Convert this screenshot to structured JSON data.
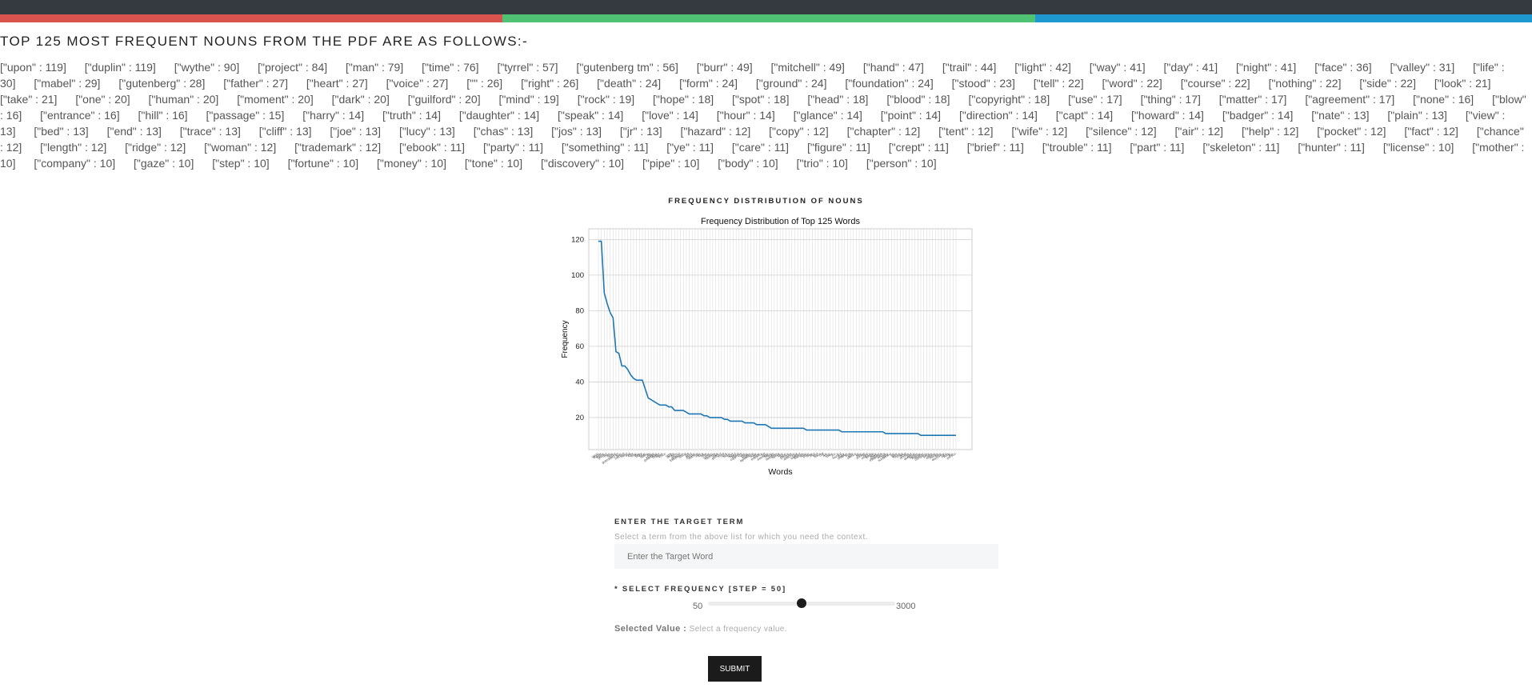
{
  "header": {
    "colors": {
      "bar": "#343a40",
      "stripe_red": "#d9534f",
      "stripe_green": "#4fc274",
      "stripe_blue": "#1f98d0"
    }
  },
  "heading": "TOP 125 MOST FREQUENT NOUNS FROM THE PDF ARE AS FOLLOWS:-",
  "words": [
    "[\"upon\" : 119]",
    "[\"duplin\" : 119]",
    "[\"wythe\" : 90]",
    "[\"project\" : 84]",
    "[\"man\" : 79]",
    "[\"time\" : 76]",
    "[\"tyrrel\" : 57]",
    "[\"gutenberg tm\" : 56]",
    "[\"burr\" : 49]",
    "[\"mitchell\" : 49]",
    "[\"hand\" : 47]",
    "[\"trail\" : 44]",
    "[\"light\" : 42]",
    "[\"way\" : 41]",
    "[\"day\" : 41]",
    "[\"night\" : 41]",
    "[\"face\" : 36]",
    "[\"valley\" : 31]",
    "[\"life\" : 30]",
    "[\"mabel\" : 29]",
    "[\"gutenberg\" : 28]",
    "[\"father\" : 27]",
    "[\"heart\" : 27]",
    "[\"voice\" : 27]",
    "[\"\" : 26]",
    "[\"right\" : 26]",
    "[\"death\" : 24]",
    "[\"form\" : 24]",
    "[\"ground\" : 24]",
    "[\"foundation\" : 24]",
    "[\"stood\" : 23]",
    "[\"tell\" : 22]",
    "[\"word\" : 22]",
    "[\"course\" : 22]",
    "[\"nothing\" : 22]",
    "[\"side\" : 22]",
    "[\"look\" : 21]",
    "[\"take\" : 21]",
    "[\"one\" : 20]",
    "[\"human\" : 20]",
    "[\"moment\" : 20]",
    "[\"dark\" : 20]",
    "[\"guilford\" : 20]",
    "[\"mind\" : 19]",
    "[\"rock\" : 19]",
    "[\"hope\" : 18]",
    "[\"spot\" : 18]",
    "[\"head\" : 18]",
    "[\"blood\" : 18]",
    "[\"copyright\" : 18]",
    "[\"use\" : 17]",
    "[\"thing\" : 17]",
    "[\"matter\" : 17]",
    "[\"agreement\" : 17]",
    "[\"none\" : 16]",
    "[\"blow\" : 16]",
    "[\"entrance\" : 16]",
    "[\"hill\" : 16]",
    "[\"passage\" : 15]",
    "[\"harry\" : 14]",
    "[\"truth\" : 14]",
    "[\"daughter\" : 14]",
    "[\"speak\" : 14]",
    "[\"love\" : 14]",
    "[\"hour\" : 14]",
    "[\"glance\" : 14]",
    "[\"point\" : 14]",
    "[\"direction\" : 14]",
    "[\"capt\" : 14]",
    "[\"howard\" : 14]",
    "[\"badger\" : 14]",
    "[\"nate\" : 13]",
    "[\"plain\" : 13]",
    "[\"view\" : 13]",
    "[\"bed\" : 13]",
    "[\"end\" : 13]",
    "[\"trace\" : 13]",
    "[\"cliff\" : 13]",
    "[\"joe\" : 13]",
    "[\"lucy\" : 13]",
    "[\"chas\" : 13]",
    "[\"jos\" : 13]",
    "[\"jr\" : 13]",
    "[\"hazard\" : 12]",
    "[\"copy\" : 12]",
    "[\"chapter\" : 12]",
    "[\"tent\" : 12]",
    "[\"wife\" : 12]",
    "[\"silence\" : 12]",
    "[\"air\" : 12]",
    "[\"help\" : 12]",
    "[\"pocket\" : 12]",
    "[\"fact\" : 12]",
    "[\"chance\" : 12]",
    "[\"length\" : 12]",
    "[\"ridge\" : 12]",
    "[\"woman\" : 12]",
    "[\"trademark\" : 12]",
    "[\"ebook\" : 11]",
    "[\"party\" : 11]",
    "[\"something\" : 11]",
    "[\"ye\" : 11]",
    "[\"care\" : 11]",
    "[\"figure\" : 11]",
    "[\"crept\" : 11]",
    "[\"brief\" : 11]",
    "[\"trouble\" : 11]",
    "[\"part\" : 11]",
    "[\"skeleton\" : 11]",
    "[\"hunter\" : 11]",
    "[\"license\" : 10]",
    "[\"mother\" : 10]",
    "[\"company\" : 10]",
    "[\"gaze\" : 10]",
    "[\"step\" : 10]",
    "[\"fortune\" : 10]",
    "[\"money\" : 10]",
    "[\"tone\" : 10]",
    "[\"discovery\" : 10]",
    "[\"pipe\" : 10]",
    "[\"body\" : 10]",
    "[\"trio\" : 10]",
    "[\"person\" : 10]"
  ],
  "chart_section_title": "FREQUENCY DISTRIBUTION OF NOUNS",
  "chart_data": {
    "type": "line",
    "title": "Frequency Distribution of Top 125 Words",
    "xlabel": "Words",
    "ylabel": "Frequency",
    "ylim": [
      0,
      125
    ],
    "yticks": [
      20,
      40,
      60,
      80,
      100,
      120
    ],
    "grid": true,
    "color": "#1f77b4",
    "x": [
      "upon",
      "duplin",
      "wythe",
      "project",
      "man",
      "time",
      "tyrrel",
      "gutenberg tm",
      "burr",
      "mitchell",
      "hand",
      "trail",
      "light",
      "way",
      "day",
      "night",
      "face",
      "valley",
      "life",
      "mabel",
      "gutenberg",
      "father",
      "heart",
      "voice",
      "",
      "right",
      "death",
      "form",
      "ground",
      "foundation",
      "stood",
      "tell",
      "word",
      "course",
      "nothing",
      "side",
      "look",
      "take",
      "one",
      "human",
      "moment",
      "dark",
      "guilford",
      "mind",
      "rock",
      "hope",
      "spot",
      "head",
      "blood",
      "copyright",
      "use",
      "thing",
      "matter",
      "agreement",
      "none",
      "blow",
      "entrance",
      "hill",
      "passage",
      "harry",
      "truth",
      "daughter",
      "speak",
      "love",
      "hour",
      "glance",
      "point",
      "direction",
      "capt",
      "howard",
      "badger",
      "nate",
      "plain",
      "view",
      "bed",
      "end",
      "trace",
      "cliff",
      "joe",
      "lucy",
      "chas",
      "jos",
      "jr",
      "hazard",
      "copy",
      "chapter",
      "tent",
      "wife",
      "silence",
      "air",
      "help",
      "pocket",
      "fact",
      "chance",
      "length",
      "ridge",
      "woman",
      "trademark",
      "ebook",
      "party",
      "something",
      "ye",
      "care",
      "figure",
      "crept",
      "brief",
      "trouble",
      "part",
      "skeleton",
      "hunter",
      "license",
      "mother",
      "company",
      "gaze",
      "step",
      "fortune",
      "money",
      "tone",
      "discovery",
      "pipe",
      "body",
      "trio",
      "person"
    ],
    "y": [
      119,
      119,
      90,
      84,
      79,
      76,
      57,
      56,
      49,
      49,
      47,
      44,
      42,
      41,
      41,
      41,
      36,
      31,
      30,
      29,
      28,
      27,
      27,
      27,
      26,
      26,
      24,
      24,
      24,
      24,
      23,
      22,
      22,
      22,
      22,
      22,
      21,
      21,
      20,
      20,
      20,
      20,
      20,
      19,
      19,
      18,
      18,
      18,
      18,
      18,
      17,
      17,
      17,
      17,
      16,
      16,
      16,
      16,
      15,
      14,
      14,
      14,
      14,
      14,
      14,
      14,
      14,
      14,
      14,
      14,
      14,
      13,
      13,
      13,
      13,
      13,
      13,
      13,
      13,
      13,
      13,
      13,
      13,
      12,
      12,
      12,
      12,
      12,
      12,
      12,
      12,
      12,
      12,
      12,
      12,
      12,
      12,
      12,
      11,
      11,
      11,
      11,
      11,
      11,
      11,
      11,
      11,
      11,
      11,
      11,
      10,
      10,
      10,
      10,
      10,
      10,
      10,
      10,
      10,
      10,
      10,
      10,
      10
    ]
  },
  "form": {
    "target_label": "ENTER THE TARGET TERM",
    "target_hint": "Select a term from the above list for which you need the context.",
    "target_placeholder": "Enter the Target Word",
    "freq_label": "* SELECT FREQUENCY [STEP = 50]",
    "freq_min": "50",
    "freq_max": "3000",
    "freq_level": 0.5,
    "selected_key": "Selected Value :",
    "selected_value": "Select a frequency value.",
    "submit_label": "SUBMIT"
  }
}
